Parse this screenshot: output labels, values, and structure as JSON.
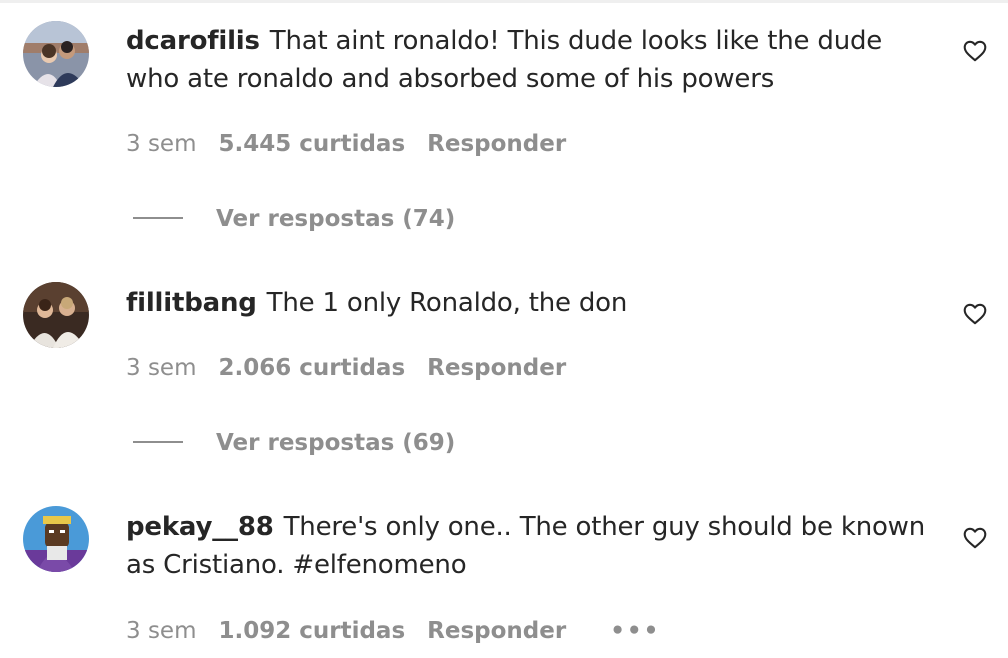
{
  "comments": [
    {
      "username": "dcarofilis",
      "text": "That aint ronaldo! This dude looks like the dude who ate ronaldo and absorbed some of his powers",
      "time": "3 sem",
      "likes": "5.445 curtidas",
      "reply_label": "Responder",
      "view_replies": "Ver respostas (74)"
    },
    {
      "username": "fillitbang",
      "text": "The 1 only Ronaldo, the don",
      "time": "3 sem",
      "likes": "2.066 curtidas",
      "reply_label": "Responder",
      "view_replies": "Ver respostas (69)"
    },
    {
      "username": "pekay__88",
      "text": "There's only one.. The other guy should be known as Cristiano. #elfenomeno",
      "time": "3 sem",
      "likes": "1.092 curtidas",
      "reply_label": "Responder",
      "more_label": "•••"
    }
  ],
  "icons": {
    "like": "heart-outline-icon",
    "more": "more-horizontal-icon"
  },
  "colors": {
    "text": "#262626",
    "secondary": "#8e8e8e"
  }
}
